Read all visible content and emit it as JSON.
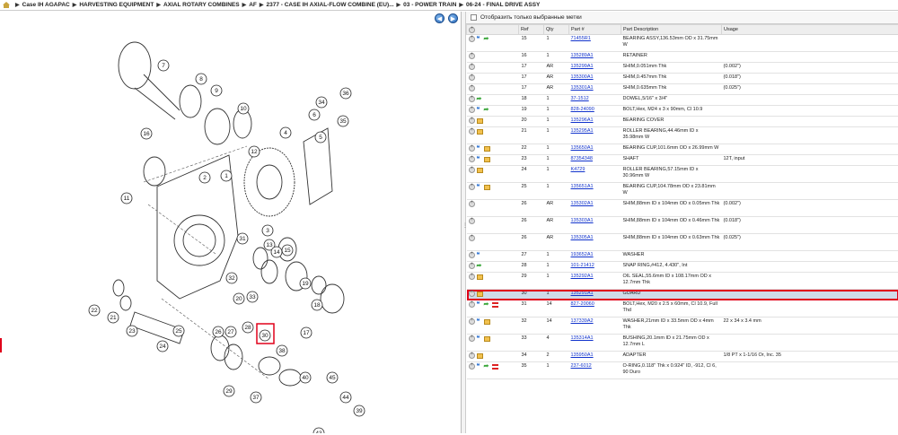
{
  "breadcrumb": [
    "Case IH AGAPAC",
    "HARVESTING EQUIPMENT",
    "AXIAL ROTARY COMBINES",
    "AF",
    "2377 - CASE IH AXIAL-FLOW COMBINE (EU)...",
    "03 - POWER TRAIN",
    "06-24 - FINAL DRIVE ASSY"
  ],
  "nav": {
    "prev": "◀",
    "next": "▶"
  },
  "filter": {
    "label": "Отобразить только выбранные метки"
  },
  "table": {
    "headers": [
      "",
      "Ref",
      "Qty",
      "Part #",
      "Part Description",
      "Usage"
    ],
    "rows": [
      {
        "ref": "15",
        "qty": "1",
        "part": "71455R1",
        "desc": "BEARING ASSY,136.53mm OD x 31.75mm W",
        "usage": "",
        "icons": [
          "info",
          "swap"
        ]
      },
      {
        "ref": "16",
        "qty": "1",
        "part": "135289A1",
        "desc": "RETAINER",
        "usage": "",
        "icons": []
      },
      {
        "ref": "17",
        "qty": "AR",
        "part": "135299A1",
        "desc": "SHIM,0.051mm Thk",
        "usage": "(0.002\")",
        "icons": []
      },
      {
        "ref": "17",
        "qty": "AR",
        "part": "135300A1",
        "desc": "SHIM,0.457mm Thk",
        "usage": "(0.018\")",
        "icons": []
      },
      {
        "ref": "17",
        "qty": "AR",
        "part": "135301A1",
        "desc": "SHIM,0.635mm Thk",
        "usage": "(0.025\")",
        "icons": []
      },
      {
        "ref": "18",
        "qty": "1",
        "part": "37-1512",
        "desc": "DOWEL,5/16\" x 3/4\"",
        "usage": "",
        "icons": [
          "swap"
        ]
      },
      {
        "ref": "19",
        "qty": "1",
        "part": "828-24090",
        "desc": "BOLT,Hex, M24 x 3 x 90mm, Cl 10.9",
        "usage": "",
        "icons": [
          "info",
          "swap"
        ]
      },
      {
        "ref": "20",
        "qty": "1",
        "part": "135296A1",
        "desc": "BEARING COVER",
        "usage": "",
        "icons": [
          "box"
        ]
      },
      {
        "ref": "21",
        "qty": "1",
        "part": "135295A1",
        "desc": "ROLLER BEARING,44.46mm ID x 35.98mm W",
        "usage": "",
        "icons": [
          "box"
        ]
      },
      {
        "ref": "22",
        "qty": "1",
        "part": "135650A1",
        "desc": "BEARING CUP,101.6mm OD x 26.99mm W",
        "usage": "",
        "icons": [
          "info",
          "box"
        ]
      },
      {
        "ref": "23",
        "qty": "1",
        "part": "87354348",
        "desc": "SHAFT",
        "usage": "12T, input",
        "icons": [
          "info",
          "box"
        ]
      },
      {
        "ref": "24",
        "qty": "1",
        "part": "K4729",
        "desc": "ROLLER BEARING,57.15mm ID x 30.96mm W",
        "usage": "",
        "icons": [
          "box"
        ]
      },
      {
        "ref": "25",
        "qty": "1",
        "part": "135651A1",
        "desc": "BEARING CUP,104.78mm OD x 23.81mm W",
        "usage": "",
        "icons": [
          "info",
          "box"
        ]
      },
      {
        "ref": "26",
        "qty": "AR",
        "part": "135302A1",
        "desc": "SHIM,88mm ID x 104mm OD x 0.05mm Thk",
        "usage": "(0.002\")",
        "icons": []
      },
      {
        "ref": "26",
        "qty": "AR",
        "part": "135303A1",
        "desc": "SHIM,88mm ID x 104mm OD x 0.46mm Thk",
        "usage": "(0.018\")",
        "icons": []
      },
      {
        "ref": "26",
        "qty": "AR",
        "part": "135305A1",
        "desc": "SHIM,88mm ID x 104mm OD x 0.63mm Thk",
        "usage": "(0.025\")",
        "icons": []
      },
      {
        "ref": "27",
        "qty": "1",
        "part": "193652A1",
        "desc": "WASHER",
        "usage": "",
        "icons": [
          "info"
        ]
      },
      {
        "ref": "28",
        "qty": "1",
        "part": "101-21412",
        "desc": "SNAP RING,#412, 4.430\", Int",
        "usage": "",
        "icons": [
          "swap"
        ]
      },
      {
        "ref": "29",
        "qty": "1",
        "part": "135292A1",
        "desc": "OIL SEAL,55.6mm ID x 108.17mm OD x 12.7mm Thk",
        "usage": "",
        "icons": [
          "box"
        ]
      },
      {
        "ref": "30",
        "qty": "1",
        "part": "135291A1",
        "desc": "GUARD",
        "usage": "",
        "icons": [
          "box"
        ],
        "selected": true
      },
      {
        "ref": "31",
        "qty": "14",
        "part": "827-20060",
        "desc": "BOLT,Hex, M20 x 2.5 x 60mm, Cl 10.9, Full Thd",
        "usage": "",
        "icons": [
          "info",
          "swap",
          "list"
        ]
      },
      {
        "ref": "32",
        "qty": "14",
        "part": "137339A2",
        "desc": "WASHER,21mm ID x 33.5mm OD x 4mm Thk",
        "usage": "22 x 34 x 3.4 mm",
        "icons": [
          "info",
          "box"
        ]
      },
      {
        "ref": "33",
        "qty": "4",
        "part": "135314A1",
        "desc": "BUSHING,20.1mm ID x 21.75mm OD x 12.7mm L",
        "usage": "",
        "icons": [
          "info",
          "box"
        ]
      },
      {
        "ref": "34",
        "qty": "2",
        "part": "135950A1",
        "desc": "ADAPTER",
        "usage": "1/8 PT x 1-1/16 Or, Inc. 35",
        "icons": [
          "box"
        ]
      },
      {
        "ref": "35",
        "qty": "1",
        "part": "237-6012",
        "desc": "O-RING,0.118\" Thk x 0.924\" ID, -912, Cl 6, 90 Duro",
        "usage": "",
        "icons": [
          "info",
          "swap",
          "list"
        ]
      }
    ]
  },
  "diagram": {
    "labels": [
      "1",
      "2",
      "3",
      "4",
      "5",
      "6",
      "7",
      "8",
      "9",
      "10",
      "11",
      "12",
      "13",
      "14",
      "15",
      "16",
      "17",
      "18",
      "19",
      "20",
      "21",
      "22",
      "23",
      "24",
      "25",
      "26",
      "27",
      "28",
      "29",
      "30",
      "31",
      "32",
      "33",
      "34",
      "35",
      "36",
      "37",
      "38",
      "39",
      "40",
      "43",
      "44",
      "45"
    ],
    "selected_label": "30"
  }
}
